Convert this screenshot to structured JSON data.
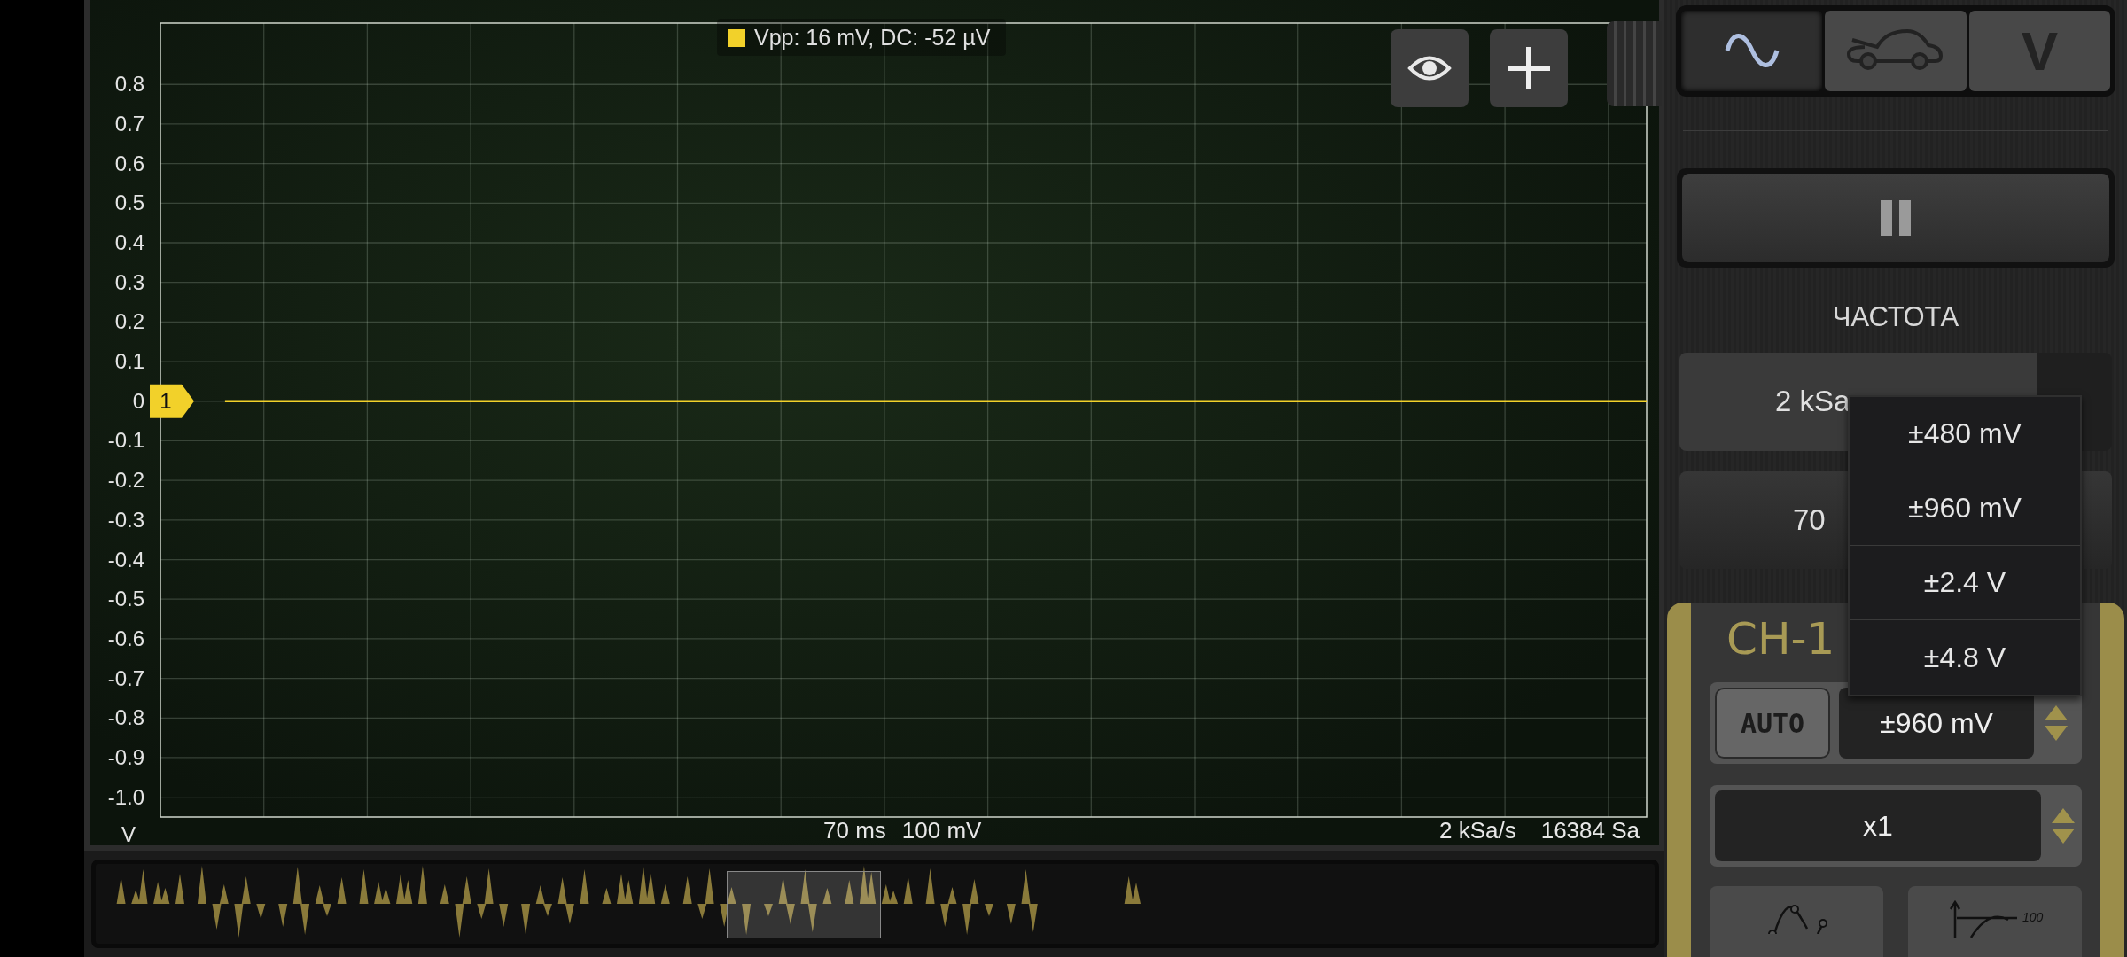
{
  "scope": {
    "legend": "Vpp: 16 mV, DC: -52 µV",
    "chart_data": {
      "type": "line",
      "grid": true,
      "ylabel": "V",
      "ylim": [
        -1.05,
        0.955
      ],
      "yticks": [
        0.8,
        0.7,
        0.6,
        0.5,
        0.4,
        0.3,
        0.2,
        0.1,
        0,
        -0.1,
        -0.2,
        -0.3,
        -0.4,
        -0.5,
        -0.6,
        -0.7,
        -0.8,
        -0.9,
        {
          "value": -1,
          "label": "-1.0"
        }
      ],
      "series": [
        {
          "name": "1",
          "color": "#f2d12a",
          "values": [
            null,
            0,
            0,
            0,
            0,
            0,
            0,
            0,
            0,
            0,
            0,
            0,
            0,
            0,
            0,
            0,
            0,
            0,
            0,
            0,
            0,
            0,
            0,
            0
          ]
        }
      ]
    },
    "timebase": "70 ms",
    "volts_per_div": "100 mV",
    "sample_rate": "2 kSa/s",
    "samples": "16384 Sa"
  },
  "mode_tabs": [
    {
      "kind": "wave",
      "selected": true
    },
    {
      "kind": "car",
      "selected": false
    },
    {
      "kind": "text",
      "label": "V",
      "selected": false
    }
  ],
  "section_label": "ЧАСТОТА",
  "sample_rate_field": {
    "value": "2 kSa"
  },
  "timebase_field": {
    "value": "70"
  },
  "range_menu": {
    "options": [
      "±480 mV",
      "±960 mV",
      "±2.4 V",
      "±4.8 V"
    ]
  },
  "channel_panel": {
    "title": "CH-1",
    "auto_button": "AUTO",
    "range_value": "±960 mV",
    "probe_value": "x1",
    "scale_icon_label": "100"
  }
}
